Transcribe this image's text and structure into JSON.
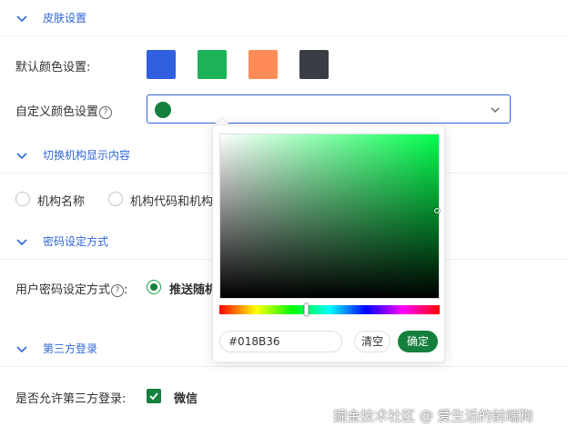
{
  "sections": {
    "skin": {
      "title": "皮肤设置"
    },
    "org_display": {
      "title": "切换机构显示内容"
    },
    "password": {
      "title": "密码设定方式"
    },
    "third_party": {
      "title": "第三方登录"
    }
  },
  "skin": {
    "default_color_label": "默认颜色设置:",
    "swatches": [
      "#3060e0",
      "#1bb356",
      "#ff8c57",
      "#3a3d44"
    ],
    "custom_color_label": "自定义颜色设置",
    "custom_color_value": "#15803d",
    "help_glyph": "?"
  },
  "org_display": {
    "options": [
      "机构名称",
      "机构代码和机构"
    ]
  },
  "password": {
    "label": "用户密码设定方式",
    "help_glyph": "?",
    "colon": ":",
    "selected_option": "推送随机"
  },
  "third_party": {
    "label": "是否允许第三方登录:",
    "checked_option": "微信"
  },
  "picker": {
    "hue_color": "#00ff4c",
    "hex_value": "#018B36",
    "clear_label": "清空",
    "confirm_label": "确定"
  },
  "watermark": "掘金技术社区 @ 爱生活的前端狗",
  "colors": {
    "accent_blue": "#2f66d8",
    "primary_green": "#15803d"
  },
  "icons": [
    "chevron-down-icon",
    "help-circle-icon",
    "select-arrow-icon",
    "checkmark-icon"
  ]
}
